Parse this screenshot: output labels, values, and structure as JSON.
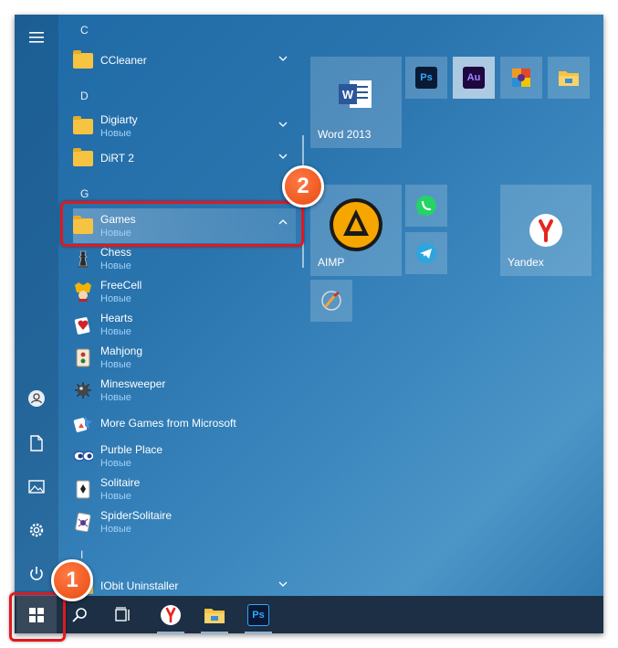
{
  "start_menu": {
    "rail": {
      "icons": [
        "hamburger-icon",
        "user-icon",
        "document-icon",
        "pictures-icon",
        "settings-icon",
        "power-icon"
      ]
    },
    "apps": [
      {
        "type": "letter",
        "label": "C"
      },
      {
        "type": "folder",
        "name": "CCleaner",
        "sub": "",
        "chevron": "down"
      },
      {
        "type": "letter",
        "label": "D"
      },
      {
        "type": "folder",
        "name": "Digiarty",
        "sub": "Новые",
        "chevron": "down"
      },
      {
        "type": "folder",
        "name": "DiRT 2",
        "sub": "",
        "chevron": "down"
      },
      {
        "type": "letter",
        "label": "G"
      },
      {
        "type": "folder",
        "name": "Games",
        "sub": "Новые",
        "chevron": "up"
      },
      {
        "type": "app",
        "name": "Chess",
        "sub": "Новые",
        "icon": "chess-icon"
      },
      {
        "type": "app",
        "name": "FreeCell",
        "sub": "Новые",
        "icon": "freecell-icon"
      },
      {
        "type": "app",
        "name": "Hearts",
        "sub": "Новые",
        "icon": "hearts-icon"
      },
      {
        "type": "app",
        "name": "Mahjong",
        "sub": "Новые",
        "icon": "mahjong-icon"
      },
      {
        "type": "app",
        "name": "Minesweeper",
        "sub": "Новые",
        "icon": "minesweeper-icon"
      },
      {
        "type": "app",
        "name": "More Games from Microsoft",
        "sub": "",
        "icon": "more-games-icon"
      },
      {
        "type": "app",
        "name": "Purble Place",
        "sub": "Новые",
        "icon": "purble-place-icon"
      },
      {
        "type": "app",
        "name": "Solitaire",
        "sub": "Новые",
        "icon": "solitaire-icon"
      },
      {
        "type": "app",
        "name": "SpiderSolitaire",
        "sub": "Новые",
        "icon": "spider-solitaire-icon"
      },
      {
        "type": "letter",
        "label": "I"
      },
      {
        "type": "folder",
        "name": "IObit Uninstaller",
        "sub": "",
        "chevron": "down"
      }
    ],
    "tiles": {
      "word": "Word 2013",
      "ps": "Ps",
      "au": "Au",
      "aimp": "AIMP",
      "yandex": "Yandex"
    }
  },
  "taskbar": {
    "items": [
      "start-button",
      "search-icon",
      "task-view-icon",
      "yandex-browser-icon",
      "file-explorer-icon",
      "photoshop-icon"
    ],
    "ps_label": "Ps"
  },
  "callouts": {
    "one": "1",
    "two": "2"
  },
  "colors": {
    "badge": "#e84a10",
    "highlight": "#e0191f",
    "subtext": "#9fd0f7"
  }
}
